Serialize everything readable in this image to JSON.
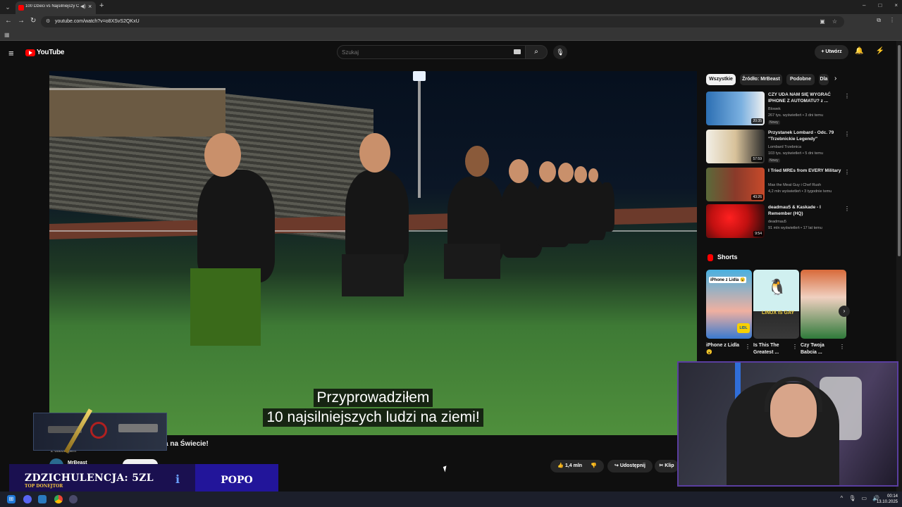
{
  "browser": {
    "tab_title": "100 Dzieci vs Najsilniejszy Człowiek",
    "url": "youtube.com/watch?v=o8XSvS2QKxU",
    "tab_audio_icon": "speaker-icon",
    "tab_close": "×",
    "tab_new": "+",
    "window_controls": [
      "–",
      "□",
      "×"
    ]
  },
  "youtube": {
    "logo_text": "YouTube",
    "search_placeholder": "Szukaj",
    "create_label": "+ Utwórz"
  },
  "video": {
    "subtitle_line1": "Przyprowadziłem",
    "subtitle_line2": "10 najsilniejszych ludzi na ziemi!",
    "title_visible": "a na Świecie!",
    "dub_label": "Z dubbingiem",
    "channel": "MrBeast",
    "likes": "1,4 mln",
    "share_label": "Udostępnij",
    "clip_label": "Klip"
  },
  "chips": [
    "Wszystkie",
    "Źródło: MrBeast",
    "Podobne",
    "Dla"
  ],
  "recommendations": [
    {
      "title": "CZY UDA NAM SIĘ WYGRAĆ IPHONE Z AUTOMATU? z ...",
      "channel": "Blowek",
      "stats": "267 tys. wyświetleń • 3 dni temu",
      "badge": "Nowy",
      "duration": "20:35",
      "thumb_color": "#2c6fb3"
    },
    {
      "title": "Przystanek Lombard - Odc. 79 \"Trzebnickie Legendy\"",
      "channel": "Lombard Trzebnica",
      "stats": "103 tys. wyświetleń • 5 dni temu",
      "badge": "Nowy",
      "duration": "57:59",
      "thumb_color": "#d8c29a"
    },
    {
      "title": "I Tried MREs from EVERY Military",
      "channel": "Max the Meat Guy i Chef Rush",
      "stats": "4,2 mln wyświetleń • 3 tygodnie temu",
      "badge": "",
      "duration": "43:26",
      "thumb_color": "#8a3a2a"
    },
    {
      "title": "deadmau5 & Kaskade - I Remember (HQ)",
      "channel": "deadmau5",
      "stats": "91 mln wyświetleń • 17 lat temu",
      "badge": "",
      "duration": "9:54",
      "thumb_color": "#c01010"
    }
  ],
  "shorts": {
    "label": "Shorts",
    "items": [
      {
        "title": "iPhone z Lidla 😮",
        "thumb_label": "iPhone z Lidla 😮",
        "thumb_color": "#4ab0e0"
      },
      {
        "title": "Is This The Greatest ...",
        "thumb_label": "LINUX IS GAY",
        "thumb_color": "#3a3a3a"
      },
      {
        "title": "Czy Twoja Babcia ...",
        "thumb_label": "",
        "thumb_color": "#2f7a3a"
      }
    ]
  },
  "overlay": {
    "donor_text": "ZDZICHULENCJA: 5ZL",
    "donor_sub": "TOP DONEJTOR",
    "donor_name": "POPO"
  },
  "taskbar": {
    "time": "00:14",
    "date": "13.10.2025"
  }
}
